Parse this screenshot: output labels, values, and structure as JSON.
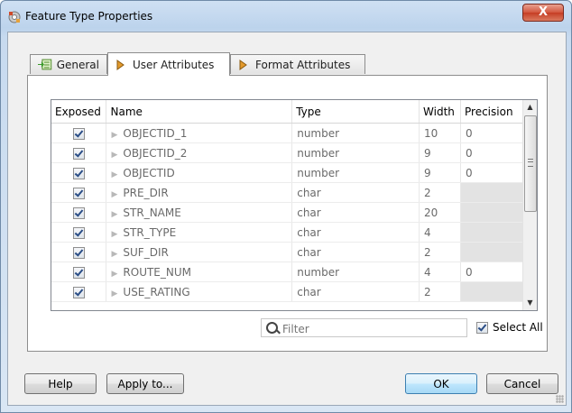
{
  "window": {
    "title": "Feature Type Properties",
    "close_glyph": "X"
  },
  "tabs": [
    {
      "label": "General",
      "icon": "general-icon"
    },
    {
      "label": "User Attributes",
      "icon": "diamond-pointer-icon"
    },
    {
      "label": "Format Attributes",
      "icon": "diamond-pointer-icon"
    }
  ],
  "grid": {
    "headers": {
      "exposed": "Exposed",
      "name": "Name",
      "type": "Type",
      "width": "Width",
      "precision": "Precision"
    },
    "rows": [
      {
        "exposed": true,
        "name": "OBJECTID_1",
        "type": "number",
        "width": "10",
        "precision": "0",
        "precision_disabled": false
      },
      {
        "exposed": true,
        "name": "OBJECTID_2",
        "type": "number",
        "width": "9",
        "precision": "0",
        "precision_disabled": false
      },
      {
        "exposed": true,
        "name": "OBJECTID",
        "type": "number",
        "width": "9",
        "precision": "0",
        "precision_disabled": false
      },
      {
        "exposed": true,
        "name": "PRE_DIR",
        "type": "char",
        "width": "2",
        "precision": "",
        "precision_disabled": true
      },
      {
        "exposed": true,
        "name": "STR_NAME",
        "type": "char",
        "width": "20",
        "precision": "",
        "precision_disabled": true
      },
      {
        "exposed": true,
        "name": "STR_TYPE",
        "type": "char",
        "width": "4",
        "precision": "",
        "precision_disabled": true
      },
      {
        "exposed": true,
        "name": "SUF_DIR",
        "type": "char",
        "width": "2",
        "precision": "",
        "precision_disabled": true
      },
      {
        "exposed": true,
        "name": "ROUTE_NUM",
        "type": "number",
        "width": "4",
        "precision": "0",
        "precision_disabled": false
      },
      {
        "exposed": true,
        "name": "USE_RATING",
        "type": "char",
        "width": "2",
        "precision": "",
        "precision_disabled": true
      }
    ]
  },
  "filter": {
    "placeholder": "Filter",
    "value": ""
  },
  "select_all": {
    "label": "Select All",
    "checked": true
  },
  "buttons": {
    "help": "Help",
    "apply_to": "Apply to...",
    "ok": "OK",
    "cancel": "Cancel"
  },
  "colors": {
    "title_gradient": "#c7daef",
    "close_red": "#c63d24",
    "ok_border": "#3c7fb1"
  }
}
